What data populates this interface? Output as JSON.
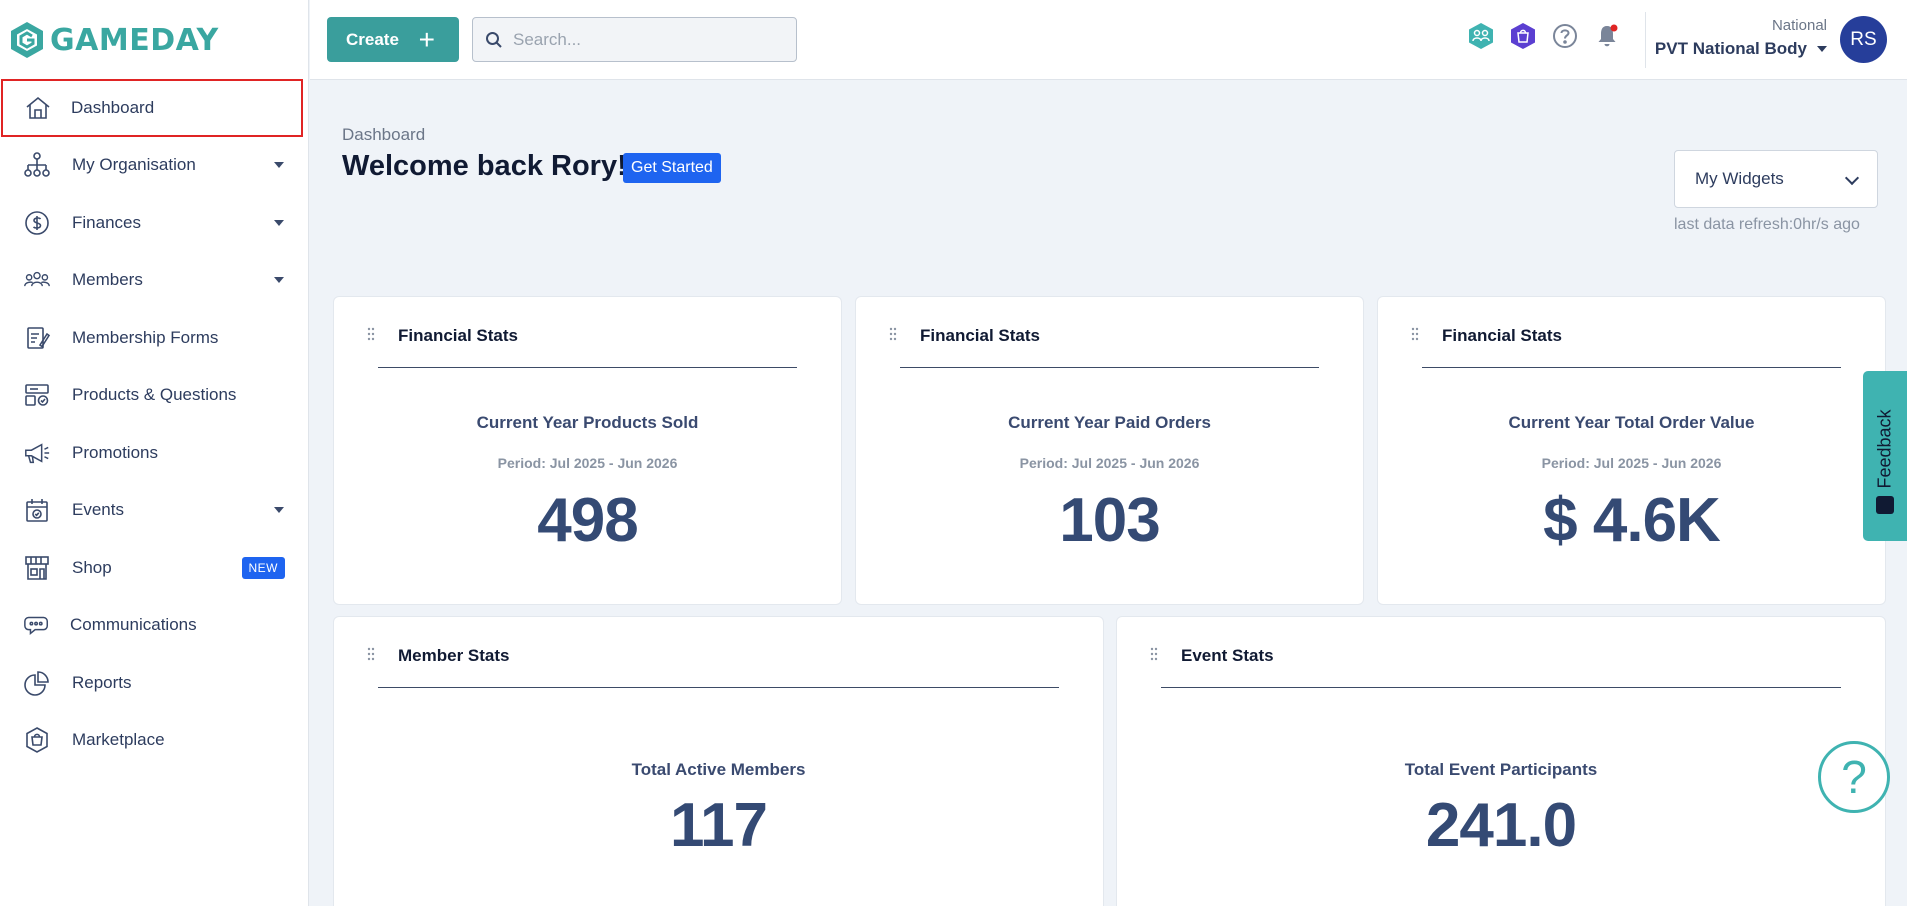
{
  "brand": {
    "name": "GAMEDAY",
    "color": "#3aa7a1"
  },
  "sidebar": {
    "items": [
      {
        "label": "Dashboard",
        "icon": "home-icon",
        "active": true
      },
      {
        "label": "My Organisation",
        "icon": "org-chart-icon",
        "has_caret": true
      },
      {
        "label": "Finances",
        "icon": "dollar-icon",
        "has_caret": true
      },
      {
        "label": "Members",
        "icon": "members-icon",
        "has_caret": true
      },
      {
        "label": "Membership Forms",
        "icon": "form-icon"
      },
      {
        "label": "Products & Questions",
        "icon": "products-icon"
      },
      {
        "label": "Promotions",
        "icon": "megaphone-icon"
      },
      {
        "label": "Events",
        "icon": "calendar-icon",
        "has_caret": true
      },
      {
        "label": "Shop",
        "icon": "shop-icon",
        "badge": "NEW"
      },
      {
        "label": "Communications",
        "icon": "chat-icon"
      },
      {
        "label": "Reports",
        "icon": "pie-chart-icon"
      },
      {
        "label": "Marketplace",
        "icon": "marketplace-icon"
      }
    ]
  },
  "topbar": {
    "create_label": "Create",
    "search_placeholder": "Search...",
    "org_level": "National",
    "org_name": "PVT National Body",
    "avatar_initials": "RS"
  },
  "main": {
    "breadcrumb": "Dashboard",
    "welcome": "Welcome back Rory!",
    "get_started": "Get Started",
    "widgets_select": "My Widgets",
    "refresh_text": "last data refresh:0hr/s ago"
  },
  "cards": [
    {
      "title": "Financial Stats",
      "label": "Current Year Products Sold",
      "period": "Period: Jul 2025 - Jun 2026",
      "value": "498"
    },
    {
      "title": "Financial Stats",
      "label": "Current Year Paid Orders",
      "period": "Period: Jul 2025 - Jun 2026",
      "value": "103"
    },
    {
      "title": "Financial Stats",
      "label": "Current Year Total Order Value",
      "period": "Period: Jul 2025 - Jun 2026",
      "value": "$ 4.6K"
    },
    {
      "title": "Member Stats",
      "label": "Total Active Members",
      "value": "117"
    },
    {
      "title": "Event Stats",
      "label": "Total Event Participants",
      "value": "241.0"
    }
  ],
  "feedback_label": "Feedback",
  "colors": {
    "accent": "#3a9e9c",
    "primary_blue": "#1e64f0",
    "stat_value": "#344a74",
    "avatar": "#263e9a"
  }
}
